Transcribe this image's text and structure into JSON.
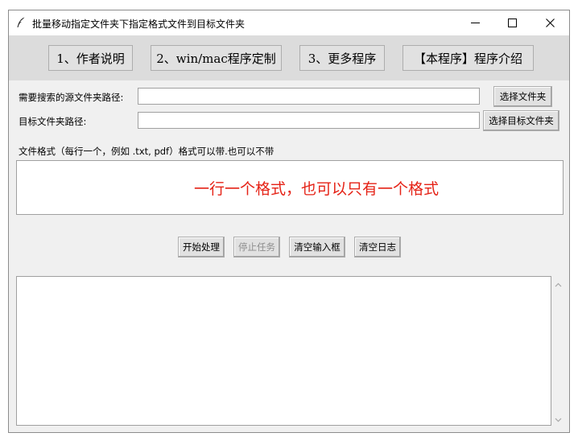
{
  "window": {
    "title": "批量移动指定文件夹下指定格式文件到目标文件夹"
  },
  "topbar": {
    "buttons": [
      {
        "label": "1、作者说明"
      },
      {
        "label": "2、win/mac程序定制"
      },
      {
        "label": "3、更多程序"
      },
      {
        "label": "【本程序】程序介绍"
      }
    ]
  },
  "form": {
    "source_label": "需要搜索的源文件夹路径:",
    "source_value": "",
    "source_button": "选择文件夹",
    "target_label": "目标文件夹路径:",
    "target_value": "",
    "target_button": "选择目标文件夹",
    "formats_label": "文件格式（每行一个，例如 .txt, pdf）格式可以带.也可以不带",
    "formats_hint": "一行一个格式，也可以只有一个格式"
  },
  "actions": {
    "start": "开始处理",
    "stop": "停止任务",
    "clear_inputs": "清空输入框",
    "clear_log": "清空日志"
  },
  "log": {
    "content": ""
  },
  "colors": {
    "hint_red": "#e52216",
    "topbar_bg": "#dcdcdc",
    "window_bg": "#f0f0f0"
  }
}
